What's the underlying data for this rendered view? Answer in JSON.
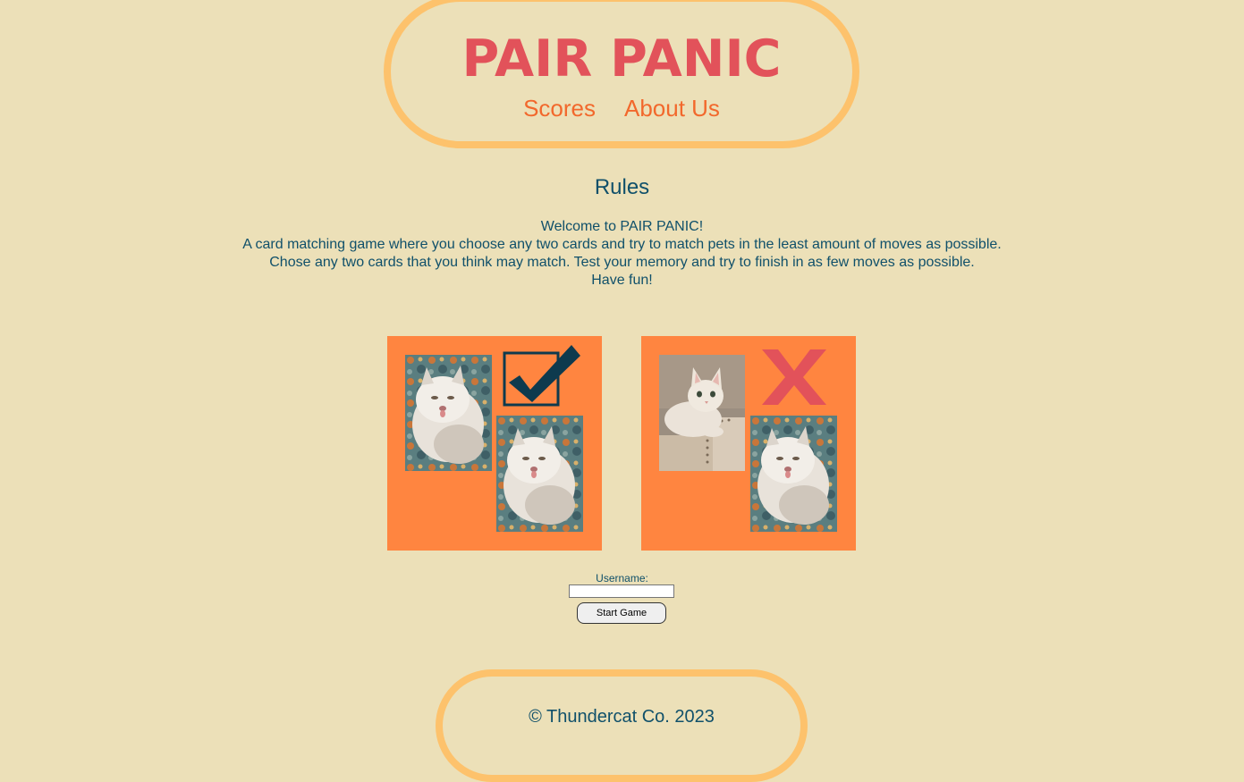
{
  "header": {
    "title": "PAIR PANIC",
    "nav": [
      {
        "label": "Scores"
      },
      {
        "label": "About Us"
      }
    ]
  },
  "rules": {
    "heading": "Rules",
    "lines": [
      "Welcome to PAIR PANIC!",
      "A card matching game where you choose any two cards and try to match pets in the least amount of moves as possible.",
      "Chose any two cards that you think may match. Test your memory and try to finish in as few moves as possible.",
      "Have fun!"
    ]
  },
  "examples": [
    {
      "result": "match",
      "icon": "checkmark-icon",
      "cards": [
        "fluffy-persian-cat-photo",
        "fluffy-persian-cat-photo"
      ]
    },
    {
      "result": "no-match",
      "icon": "x-icon",
      "cards": [
        "white-cat-on-chair-photo",
        "fluffy-persian-cat-photo"
      ]
    }
  ],
  "form": {
    "username_label": "Username:",
    "username_value": "",
    "start_label": "Start Game"
  },
  "footer": {
    "text": "© Thundercat Co. 2023"
  },
  "colors": {
    "background": "#ece0b8",
    "border": "#fdc26c",
    "title": "#e2525a",
    "nav": "#f2682c",
    "text": "#10506a",
    "card_bg": "#ff8540"
  }
}
